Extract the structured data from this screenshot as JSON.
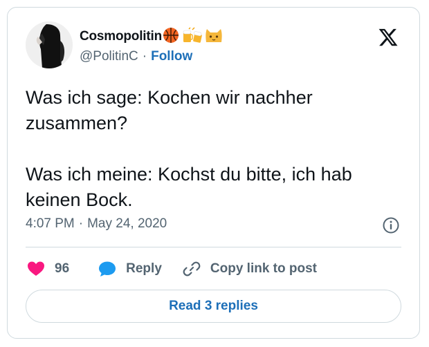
{
  "author": {
    "display_name": "Cosmopolitin",
    "name_emojis": "🏀🍻🐱",
    "handle": "@PolitinC",
    "separator": "·",
    "follow_label": "Follow"
  },
  "tweet": {
    "text": "Was ich sage: Kochen wir nachher zusammen?\n\nWas ich meine: Kochst du bitte, ich hab keinen Bock.",
    "time": "4:07 PM",
    "separator": "·",
    "date": "May 24, 2020"
  },
  "actions": {
    "like_count": "96",
    "reply_label": "Reply",
    "copy_label": "Copy link to post"
  },
  "replies_button": {
    "label": "Read 3 replies"
  },
  "icons": {
    "logo": "x-logo-icon",
    "info": "info-icon",
    "like": "heart-icon",
    "reply": "speech-bubble-icon",
    "copy": "link-icon"
  },
  "colors": {
    "text_primary": "#0f1419",
    "text_secondary": "#536471",
    "link_blue": "#1d6fb8",
    "heart_pink": "#f91880",
    "reply_blue": "#1d9bf0",
    "border": "#cfd9de"
  }
}
